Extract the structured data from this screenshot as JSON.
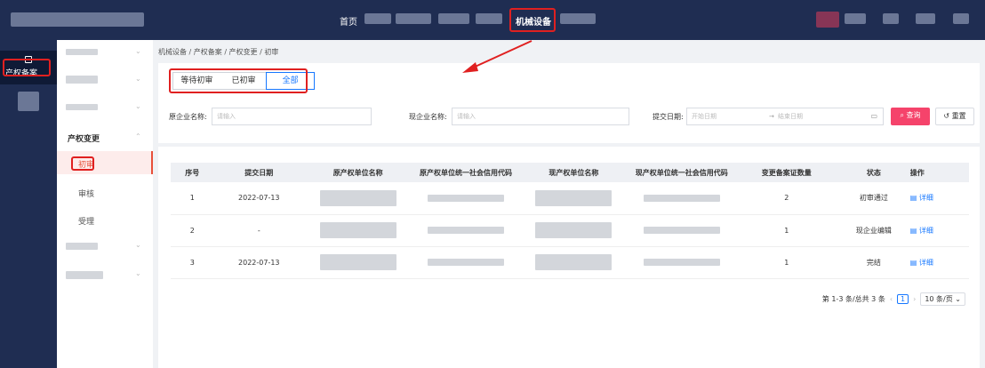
{
  "topnav": {
    "home": "首页",
    "active": "机械设备"
  },
  "rail": {
    "active": "产权备案"
  },
  "submenu": {
    "group": "产权变更",
    "items": [
      "初审",
      "审核",
      "受理"
    ]
  },
  "breadcrumb": "机械设备 / 产权备案 / 产权变更 / 初审",
  "tabs": [
    "等待初审",
    "已初审",
    "全部"
  ],
  "filters": {
    "orig_label": "原企业名称:",
    "orig_ph": "请输入",
    "cur_label": "现企业名称:",
    "cur_ph": "请输入",
    "date_label": "提交日期:",
    "start_ph": "开始日期",
    "end_ph": "结束日期",
    "query": "查询",
    "reset": "重置"
  },
  "table": {
    "headers": [
      "序号",
      "提交日期",
      "原产权单位名称",
      "原产权单位统一社会信用代码",
      "现产权单位名称",
      "现产权单位统一社会信用代码",
      "变更备案证数量",
      "状态",
      "操作"
    ],
    "rows": [
      {
        "no": "1",
        "date": "2022-07-13",
        "count": "2",
        "status": "初审通过",
        "action": "详细"
      },
      {
        "no": "2",
        "date": "-",
        "count": "1",
        "status": "现企业编辑",
        "action": "详细"
      },
      {
        "no": "3",
        "date": "2022-07-13",
        "count": "1",
        "status": "完结",
        "action": "详细"
      }
    ]
  },
  "pagination": {
    "summary": "第 1-3 条/总共 3 条",
    "page": "1",
    "per_page": "10 条/页"
  },
  "colors": {
    "nav": "#1f2d52",
    "accent": "#1677ff",
    "query": "#f5436b",
    "highlight": "#e02020"
  }
}
